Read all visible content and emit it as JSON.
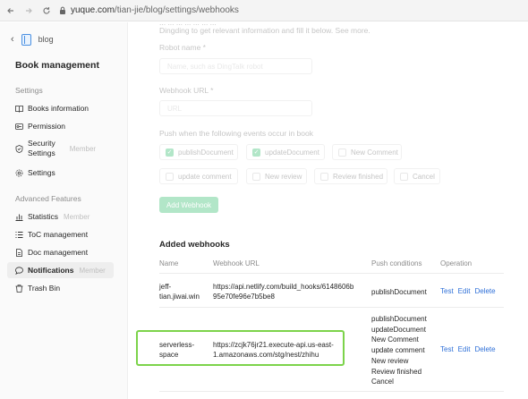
{
  "browser": {
    "url_domain": "yuque.com",
    "url_path": "/tian-jie/blog/settings/webhooks"
  },
  "sidebar": {
    "back_label": "blog",
    "title": "Book management",
    "settings_section": "Settings",
    "items": [
      {
        "label": "Books information"
      },
      {
        "label": "Permission"
      },
      {
        "label_line1": "Security",
        "label_line2": "Settings",
        "badge": "Member"
      },
      {
        "label": "Settings"
      }
    ],
    "advanced_section": "Advanced Features",
    "advanced_items": [
      {
        "label": "Statistics",
        "badge": "Member"
      },
      {
        "label": "ToC management"
      },
      {
        "label": "Doc management"
      },
      {
        "label": "Notifications",
        "badge": "Member"
      },
      {
        "label": "Trash Bin"
      }
    ]
  },
  "form": {
    "intro_line1": "... ... ... ... ... ... ...",
    "intro_line2": "Dingding to get relevant information and fill it below. See more.",
    "robot_name_label": "Robot name *",
    "robot_name_placeholder": "Name, such as DingTalk robot",
    "webhook_url_label": "Webhook URL *",
    "webhook_url_placeholder": "URL",
    "events_label": "Push when the following events occur in book",
    "events": [
      {
        "label": "publishDocument",
        "checked": true
      },
      {
        "label": "updateDocument",
        "checked": true
      },
      {
        "label": "New Comment",
        "checked": false
      },
      {
        "label": "update comment",
        "checked": false
      },
      {
        "label": "New review",
        "checked": false
      },
      {
        "label": "Review finished",
        "checked": false
      },
      {
        "label": "Cancel",
        "checked": false
      }
    ],
    "add_button": "Add Webhook"
  },
  "added": {
    "title": "Added webhooks",
    "columns": [
      "Name",
      "Webhook URL",
      "Push conditions",
      "Operation"
    ],
    "rows": [
      {
        "name_line1": "jeff-",
        "name_line2": "tian.jiwai.win",
        "url_line1": "https://api.netlify.com/build_hooks/6148606b",
        "url_line2": "95e70fe96e7b5be8",
        "conditions": [
          "publishDocument"
        ],
        "ops": [
          "Test",
          "Edit",
          "Delete"
        ]
      },
      {
        "name_line1": "serverless-",
        "name_line2": "space",
        "url_line1": "https://zcjk76jr21.execute-api.us-east-",
        "url_line2": "1.amazonaws.com/stg/nest/zhihu",
        "conditions": [
          "publishDocument",
          "updateDocument",
          "New Comment",
          "update comment",
          "New review",
          "Review finished",
          "Cancel"
        ],
        "ops": [
          "Test",
          "Edit",
          "Delete"
        ]
      }
    ]
  },
  "colors": {
    "accent": "#25b864",
    "link": "#2f70d8",
    "highlight": "#7cd34a"
  }
}
